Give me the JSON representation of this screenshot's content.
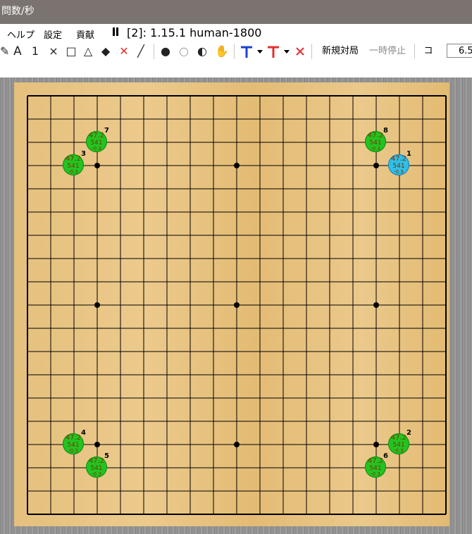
{
  "window": {
    "title": "問数/秒"
  },
  "menu": {
    "items": [
      "ヘルプ",
      "設定",
      "貢献"
    ],
    "status": "[2]: 1.15.1 human-1800"
  },
  "toolbar": {
    "tools": [
      "✎",
      "A",
      "1",
      "×",
      "□",
      "△",
      "◆",
      "✕",
      "╱"
    ],
    "stones": [
      "●",
      "○",
      "◐",
      "✋"
    ],
    "new_game": "新規対局",
    "pause": "一時停止",
    "komi_label": "コミ",
    "komi_value": "6.5"
  },
  "board": {
    "size": 19,
    "candidates": [
      {
        "order": "1",
        "col": 16,
        "row": 3,
        "winrate": "47.2",
        "visits": "541",
        "score": "-0.3",
        "best": true
      },
      {
        "order": "2",
        "col": 16,
        "row": 15,
        "winrate": "47.2",
        "visits": "541",
        "score": "-0.3",
        "best": false
      },
      {
        "order": "3",
        "col": 2,
        "row": 3,
        "winrate": "47.2",
        "visits": "541",
        "score": "-0.3",
        "best": false
      },
      {
        "order": "4",
        "col": 2,
        "row": 15,
        "winrate": "47.2",
        "visits": "541",
        "score": "-0.3",
        "best": false
      },
      {
        "order": "5",
        "col": 3,
        "row": 16,
        "winrate": "47.2",
        "visits": "541",
        "score": "-0.3",
        "best": false
      },
      {
        "order": "6",
        "col": 15,
        "row": 16,
        "winrate": "47.2",
        "visits": "541",
        "score": "-0.3",
        "best": false
      },
      {
        "order": "7",
        "col": 3,
        "row": 2,
        "winrate": "47.2",
        "visits": "541",
        "score": "-0.3",
        "best": false
      },
      {
        "order": "8",
        "col": 15,
        "row": 2,
        "winrate": "47.2",
        "visits": "541",
        "score": "-0.3",
        "best": false
      }
    ]
  }
}
